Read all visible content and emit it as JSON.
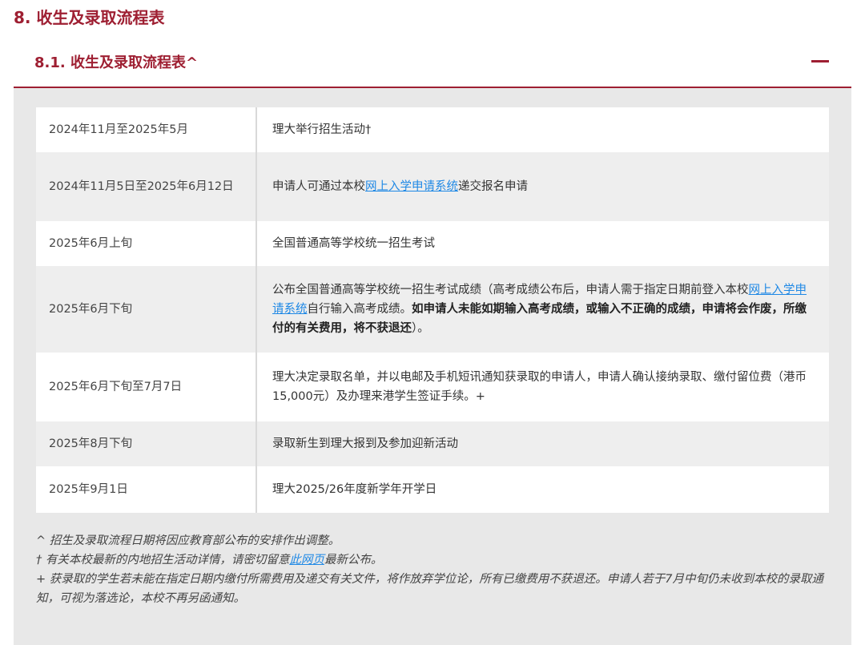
{
  "section": {
    "title": "8. 收生及录取流程表"
  },
  "subsection": {
    "title": "8.1. 收生及录取流程表^",
    "toggle_icon": "minus-icon"
  },
  "schedule": [
    {
      "date": "2024年11月至2025年5月",
      "desc": "理大举行招生活动†"
    },
    {
      "date": "2024年11月5日至2025年6月12日",
      "desc_pre": "申请人可通过本校",
      "desc_link": "网上入学申请系统",
      "desc_post": "递交报名申请"
    },
    {
      "date": "2025年6月上旬",
      "desc": "全国普通高等学校统一招生考试"
    },
    {
      "date": "2025年6月下旬",
      "desc_pre": "公布全国普通高等学校统一招生考试成绩（高考成绩公布后，申请人需于指定日期前登入本校",
      "desc_link": "网上入学申请系统",
      "desc_mid": "自行输入高考成绩。",
      "desc_bold": "如申请人未能如期输入高考成绩，或输入不正确的成绩，申请将会作废，所缴付的有关费用，将不获退还",
      "desc_post": "）。"
    },
    {
      "date": "2025年6月下旬至7月7日",
      "desc": "理大决定录取名单，并以电邮及手机短讯通知获录取的申请人，申请人确认接纳录取、缴付留位费（港币15,000元）及办理来港学生签证手续。+"
    },
    {
      "date": "2025年8月下旬",
      "desc": "录取新生到理大报到及参加迎新活动"
    },
    {
      "date": "2025年9月1日",
      "desc": "理大2025/26年度新学年开学日"
    }
  ],
  "notes": {
    "caret": "^ 招生及录取流程日期将因应教育部公布的安排作出调整。",
    "dagger_pre": "† 有关本校最新的内地招生活动详情，请密切留意",
    "dagger_link": "此网页",
    "dagger_post": "最新公布。",
    "plus": "+ 获录取的学生若未能在指定日期内缴付所需费用及递交有关文件，将作放弃学位论，所有已缴费用不获退还。申请人若于7月中旬仍未收到本校的录取通知，可视为落选论，本校不再另函通知。"
  },
  "colors": {
    "accent": "#9e1f32",
    "link": "#1e88e5",
    "panel": "#e8e8e8"
  }
}
